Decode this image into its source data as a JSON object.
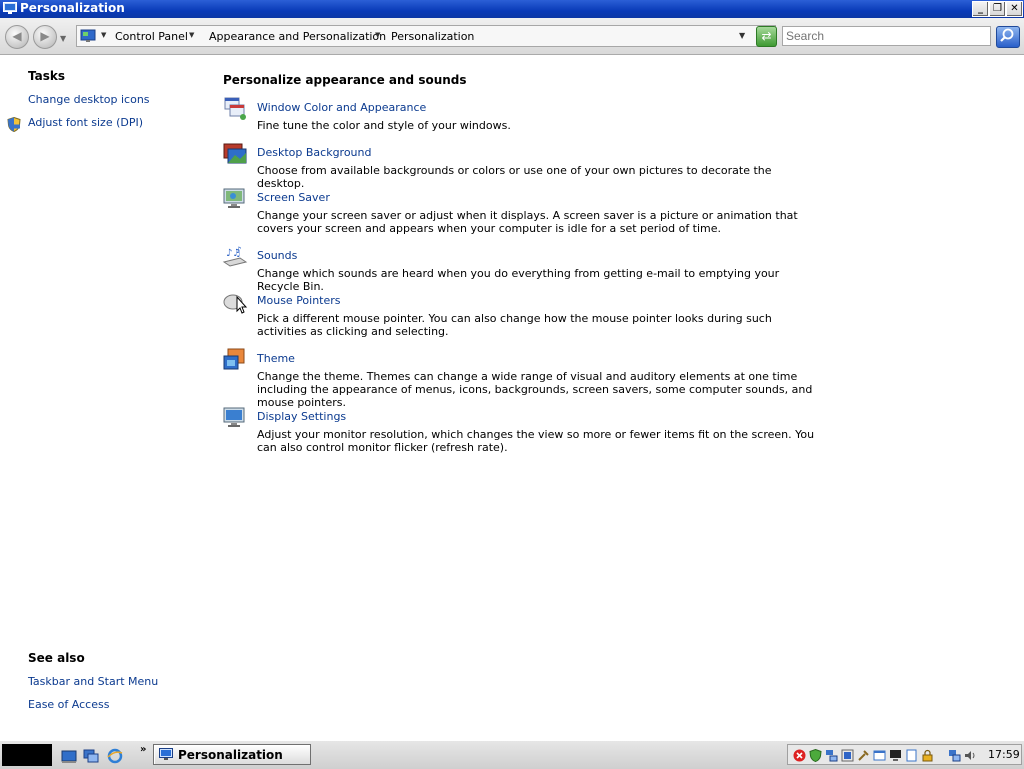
{
  "window": {
    "title": "Personalization",
    "buttons": {
      "minimize": "_",
      "maximize": "❐",
      "close": "✕"
    }
  },
  "toolbar": {
    "back_icon": "back-arrow-icon",
    "forward_icon": "forward-arrow-icon",
    "breadcrumb": [
      "Control Panel",
      "Appearance and Personalization",
      "Personalization"
    ],
    "search_placeholder": "Search"
  },
  "left_pane": {
    "tasks_heading": "Tasks",
    "tasks": [
      {
        "label": "Change desktop icons"
      },
      {
        "label": "Adjust font size (DPI)",
        "icon": "uac-shield-icon"
      }
    ],
    "see_also_heading": "See also",
    "see_also": [
      {
        "label": "Taskbar and Start Menu"
      },
      {
        "label": "Ease of Access"
      }
    ]
  },
  "main": {
    "heading": "Personalize appearance and sounds",
    "items": [
      {
        "name": "Window Color and Appearance",
        "icon": "window-color-icon",
        "description": "Fine tune the color and style of your windows."
      },
      {
        "name": "Desktop Background",
        "icon": "desktop-background-icon",
        "description": "Choose from available backgrounds or colors or use one of your own pictures to decorate the desktop."
      },
      {
        "name": "Screen Saver",
        "icon": "screen-saver-icon",
        "description": "Change your screen saver or adjust when it displays. A screen saver is a picture or animation that covers your screen and appears when your computer is idle for a set period of time."
      },
      {
        "name": "Sounds",
        "icon": "sounds-icon",
        "description": "Change which sounds are heard when you do everything from getting e-mail to emptying your Recycle Bin."
      },
      {
        "name": "Mouse Pointers",
        "icon": "mouse-pointers-icon",
        "description": "Pick a different mouse pointer. You can also change how the mouse pointer looks during such activities as clicking and selecting."
      },
      {
        "name": "Theme",
        "icon": "theme-icon",
        "description": "Change the theme. Themes can change a wide range of visual and auditory elements at one time including the appearance of menus, icons, backgrounds, screen savers, some computer sounds, and mouse pointers."
      },
      {
        "name": "Display Settings",
        "icon": "display-settings-icon",
        "description": "Adjust your monitor resolution, which changes the view so more or fewer items fit on the screen. You can also control monitor flicker (refresh rate)."
      }
    ]
  },
  "taskbar": {
    "more_quick_launch": "»",
    "active_task": "Personalization",
    "clock": "17:59"
  },
  "colors": {
    "link": "#0b3a8f",
    "titlebar": "#0a3bb8"
  }
}
